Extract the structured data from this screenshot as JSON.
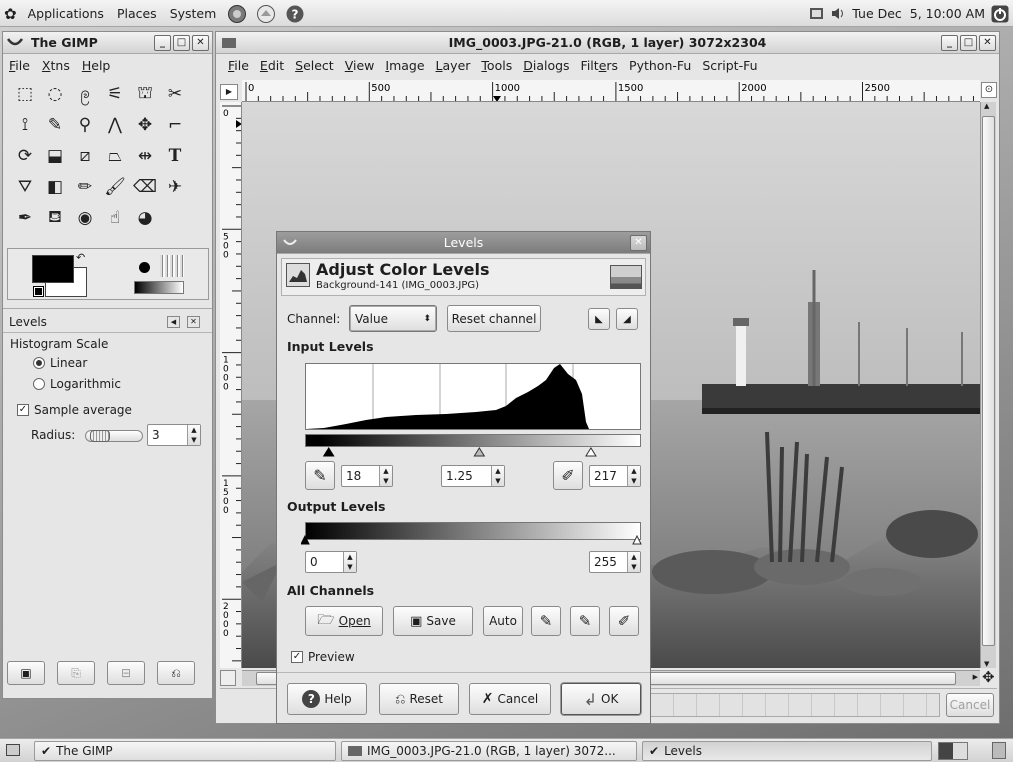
{
  "panel": {
    "menus": [
      "Applications",
      "Places",
      "System"
    ],
    "clock": "Tue Dec  5, 10:00 AM"
  },
  "toolbox": {
    "title": "The GIMP",
    "menus": [
      "File",
      "Xtns",
      "Help"
    ],
    "tools": [
      "rect-select",
      "ellipse-select",
      "free-select",
      "fuzzy-select",
      "color-select",
      "scissors",
      "paths",
      "color-picker",
      "zoom",
      "measure",
      "move",
      "crop",
      "rotate",
      "scale",
      "shear",
      "perspective",
      "flip",
      "text",
      "bucket-fill",
      "blend",
      "pencil",
      "paintbrush",
      "eraser",
      "airbrush",
      "ink",
      "clone",
      "blur",
      "smudge",
      "dodge-burn"
    ],
    "fg_color": "#000000",
    "bg_color": "#ffffff"
  },
  "levels_dock": {
    "title": "Levels",
    "histogram_scale_label": "Histogram Scale",
    "linear_label": "Linear",
    "logarithmic_label": "Logarithmic",
    "selected_scale": "Linear",
    "sample_average_label": "Sample average",
    "sample_average_checked": true,
    "radius_label": "Radius:",
    "radius_value": "3",
    "radius_slider_fraction": 0.1
  },
  "image_window": {
    "title": "IMG_0003.JPG-21.0 (RGB, 1 layer) 3072x2304",
    "menus": [
      "File",
      "Edit",
      "Select",
      "View",
      "Image",
      "Layer",
      "Tools",
      "Dialogs",
      "Filters",
      "Python-Fu",
      "Script-Fu"
    ],
    "ruler_labels": [
      "0",
      "500",
      "1000",
      "1500",
      "2000",
      "2500"
    ],
    "vruler_labels": [
      "0",
      "500",
      "1000",
      "1500",
      "2000"
    ],
    "cancel_label": "Cancel"
  },
  "levels_dialog": {
    "window_title": "Levels",
    "heading": "Adjust Color Levels",
    "subheading": "Background-141 (IMG_0003.JPG)",
    "channel_label": "Channel:",
    "channel_value": "Value",
    "reset_channel_label": "Reset channel",
    "input_levels_label": "Input Levels",
    "input_low": "18",
    "input_gamma": "1.25",
    "input_high": "217",
    "output_levels_label": "Output Levels",
    "output_low": "0",
    "output_high": "255",
    "all_channels_label": "All Channels",
    "open_label": "Open",
    "save_label": "Save",
    "auto_label": "Auto",
    "preview_label": "Preview",
    "preview_checked": true,
    "help_label": "Help",
    "reset_label": "Reset",
    "cancel_label": "Cancel",
    "ok_label": "OK"
  },
  "taskbar": {
    "items": [
      "The GIMP",
      "IMG_0003.JPG-21.0 (RGB, 1 layer) 3072...",
      "Levels"
    ]
  }
}
